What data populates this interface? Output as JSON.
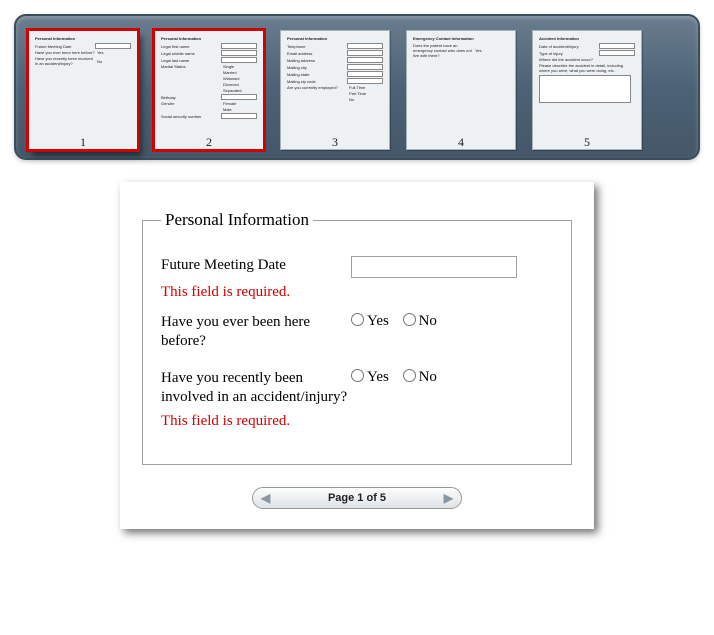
{
  "strip": {
    "pages": [
      {
        "num": "1",
        "selected": true,
        "header": "Personal Information",
        "lines": [
          {
            "label": "Future Meeting Date",
            "field": "box"
          },
          {
            "label": "Have you ever been here before?",
            "field": "opt",
            "opt": "Yes"
          },
          {
            "label": "Have you recently been involved in an accident/injury?",
            "field": "opt",
            "opt": "No"
          }
        ]
      },
      {
        "num": "2",
        "selected": true,
        "header": "Personal Information",
        "lines": [
          {
            "label": "Legal first name",
            "field": "box"
          },
          {
            "label": "Legal middle name",
            "field": "box"
          },
          {
            "label": "Legal last name",
            "field": "box"
          },
          {
            "label": "Marital Status",
            "field": "opt",
            "opt": "Single"
          },
          {
            "label": "",
            "field": "opt",
            "opt": "Married"
          },
          {
            "label": "",
            "field": "opt",
            "opt": "Widowed"
          },
          {
            "label": "",
            "field": "opt",
            "opt": "Divorced"
          },
          {
            "label": "",
            "field": "opt",
            "opt": "Separated"
          },
          {
            "label": "Birthday",
            "field": "box"
          },
          {
            "label": "Gender",
            "field": "opt",
            "opt": "Female"
          },
          {
            "label": "",
            "field": "opt",
            "opt": "Male"
          },
          {
            "label": "Social security number",
            "field": "box"
          }
        ]
      },
      {
        "num": "3",
        "selected": false,
        "header": "Personal Information",
        "lines": [
          {
            "label": "Telephone",
            "field": "box"
          },
          {
            "label": "Email address",
            "field": "box"
          },
          {
            "label": "Mailing address",
            "field": "box"
          },
          {
            "label": "Mailing city",
            "field": "box"
          },
          {
            "label": "Mailing state",
            "field": "box"
          },
          {
            "label": "Mailing zip code",
            "field": "box"
          },
          {
            "label": "Are you currently employed?",
            "field": "opt",
            "opt": "Full Time"
          },
          {
            "label": "",
            "field": "opt",
            "opt": "Part Time"
          },
          {
            "label": "",
            "field": "opt",
            "opt": "No"
          }
        ]
      },
      {
        "num": "4",
        "selected": false,
        "header": "Emergency Contact Information",
        "lines": [
          {
            "label": "Does the patient have an emergency contact who does not live with them?",
            "field": "opt",
            "opt": "Yes"
          }
        ]
      },
      {
        "num": "5",
        "selected": false,
        "header": "Accident Information",
        "textarea": true,
        "lines": [
          {
            "label": "Date of accident/injury",
            "field": "box"
          },
          {
            "label": "Type of injury",
            "field": "box"
          },
          {
            "label": "Where did the accident occur?",
            "field": ""
          },
          {
            "label": "Please describe the accident in detail, including where you were, what you were doing, etc.",
            "field": ""
          }
        ]
      }
    ]
  },
  "form": {
    "legend": "Personal Information",
    "q1": "Future Meeting Date",
    "q1_value": "",
    "err1": "This field is required.",
    "q2": "Have you ever been here before?",
    "q3": "Have you recently been involved in an accident/injury?",
    "err3": "This field is required.",
    "yes": "Yes",
    "no": "No"
  },
  "pager": {
    "text": "Page 1 of 5"
  }
}
